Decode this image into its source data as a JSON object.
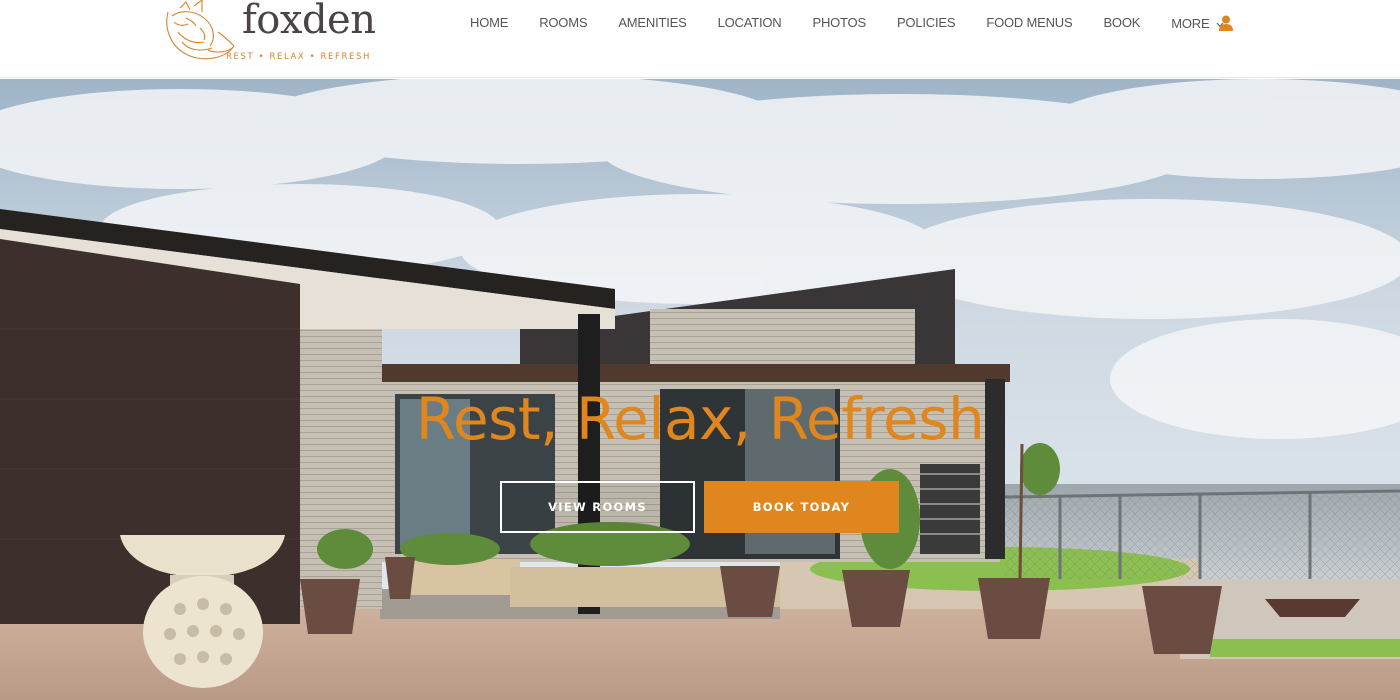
{
  "brand": {
    "name": "foxden",
    "tagline": "REST • RELAX • REFRESH",
    "accent_color": "#e0861e",
    "logo_icon": "fox-logo-icon"
  },
  "nav": {
    "items": [
      {
        "label": "HOME"
      },
      {
        "label": "ROOMS"
      },
      {
        "label": "AMENITIES"
      },
      {
        "label": "LOCATION"
      },
      {
        "label": "PHOTOS"
      },
      {
        "label": "POLICIES"
      },
      {
        "label": "FOOD MENUS"
      },
      {
        "label": "BOOK"
      },
      {
        "label": "MORE"
      }
    ],
    "more_icon": "chevron-down-icon",
    "user_icon": "user-icon"
  },
  "hero": {
    "title": "Rest, Relax, Refresh",
    "buttons": {
      "view_rooms": "VIEW ROOMS",
      "book_today": "BOOK TODAY"
    }
  }
}
